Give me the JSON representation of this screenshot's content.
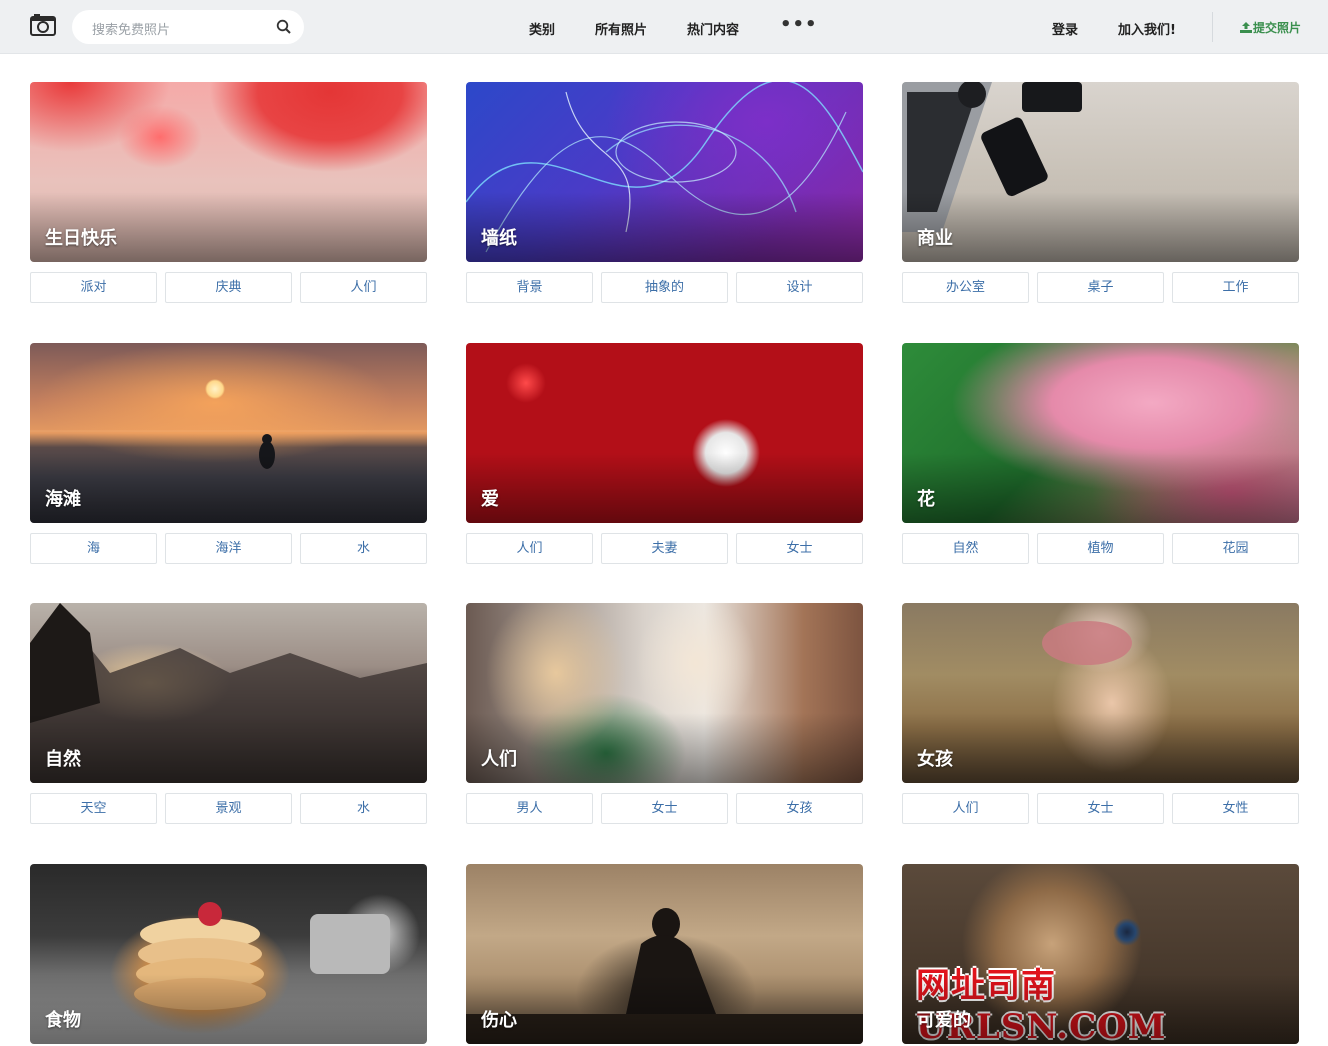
{
  "header": {
    "search_placeholder": "搜索免费照片",
    "nav": {
      "categories": "类别",
      "all_photos": "所有照片",
      "hot": "热门内容",
      "more": "•••"
    },
    "login": "登录",
    "join": "加入我们!",
    "submit": "提交照片"
  },
  "cards": [
    {
      "title": "生日快乐",
      "tags": [
        "派对",
        "庆典",
        "人们"
      ]
    },
    {
      "title": "墙纸",
      "tags": [
        "背景",
        "抽象的",
        "设计"
      ]
    },
    {
      "title": "商业",
      "tags": [
        "办公室",
        "桌子",
        "工作"
      ]
    },
    {
      "title": "海滩",
      "tags": [
        "海",
        "海洋",
        "水"
      ]
    },
    {
      "title": "爱",
      "tags": [
        "人们",
        "夫妻",
        "女士"
      ]
    },
    {
      "title": "花",
      "tags": [
        "自然",
        "植物",
        "花园"
      ]
    },
    {
      "title": "自然",
      "tags": [
        "天空",
        "景观",
        "水"
      ]
    },
    {
      "title": "人们",
      "tags": [
        "男人",
        "女士",
        "女孩"
      ]
    },
    {
      "title": "女孩",
      "tags": [
        "人们",
        "女士",
        "女性"
      ]
    },
    {
      "title": "食物"
    },
    {
      "title": "伤心"
    },
    {
      "title": "可爱的",
      "watermark": "网址司南 URLSN.COM"
    }
  ],
  "colors": {
    "tag_text": "#3d6fa8",
    "submit_green": "#3a8f4e",
    "header_bg": "#eef0f2"
  }
}
